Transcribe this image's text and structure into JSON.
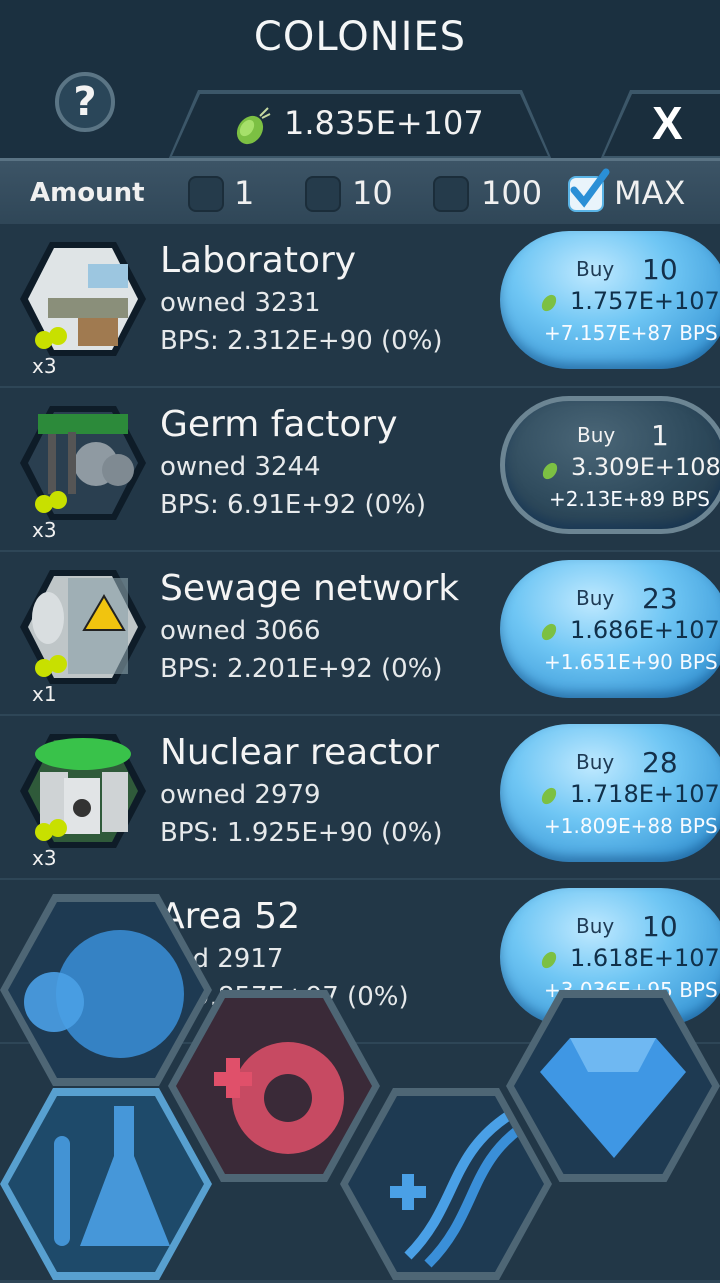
{
  "header": {
    "title": "COLONIES",
    "help_label": "?",
    "currency": "1.835E+107",
    "close_label": "X"
  },
  "amount_bar": {
    "label": "Amount",
    "options": [
      {
        "label": "1",
        "checked": false
      },
      {
        "label": "10",
        "checked": false
      },
      {
        "label": "100",
        "checked": false
      },
      {
        "label": "MAX",
        "checked": true
      }
    ]
  },
  "colonies": [
    {
      "name": "Laboratory",
      "owned": "owned 3231",
      "bps": "BPS: 2.312E+90 (0%)",
      "mult": "x3",
      "buy_word": "Buy",
      "buy_qty": "10",
      "cost": "1.757E+107",
      "gain": "+7.157E+87 BPS",
      "affordable": true
    },
    {
      "name": "Germ factory",
      "owned": "owned 3244",
      "bps": "BPS: 6.91E+92 (0%)",
      "mult": "x3",
      "buy_word": "Buy",
      "buy_qty": "1",
      "cost": "3.309E+108",
      "gain": "+2.13E+89 BPS",
      "affordable": false
    },
    {
      "name": "Sewage network",
      "owned": "owned 3066",
      "bps": "BPS: 2.201E+92 (0%)",
      "mult": "x1",
      "buy_word": "Buy",
      "buy_qty": "23",
      "cost": "1.686E+107",
      "gain": "+1.651E+90 BPS",
      "affordable": true
    },
    {
      "name": "Nuclear reactor",
      "owned": "owned 2979",
      "bps": "BPS: 1.925E+90 (0%)",
      "mult": "x3",
      "buy_word": "Buy",
      "buy_qty": "28",
      "cost": "1.718E+107",
      "gain": "+1.809E+88 BPS",
      "affordable": true
    },
    {
      "name": "Area 52",
      "owned": "ned 2917",
      "bps": "... 9.857E+97 (0%)",
      "mult": "",
      "buy_word": "Buy",
      "buy_qty": "10",
      "cost": "1.618E+107",
      "gain": "+3.036E+95 BPS",
      "affordable": true
    }
  ],
  "nav": {
    "items": [
      "bubbles-icon",
      "upgrade-gear-icon",
      "dna-upgrade-icon",
      "gem-icon",
      "flask-icon"
    ]
  },
  "colors": {
    "accent": "#5ab4e6",
    "germ": "#8fd14f",
    "hazard": "#c8e000"
  }
}
